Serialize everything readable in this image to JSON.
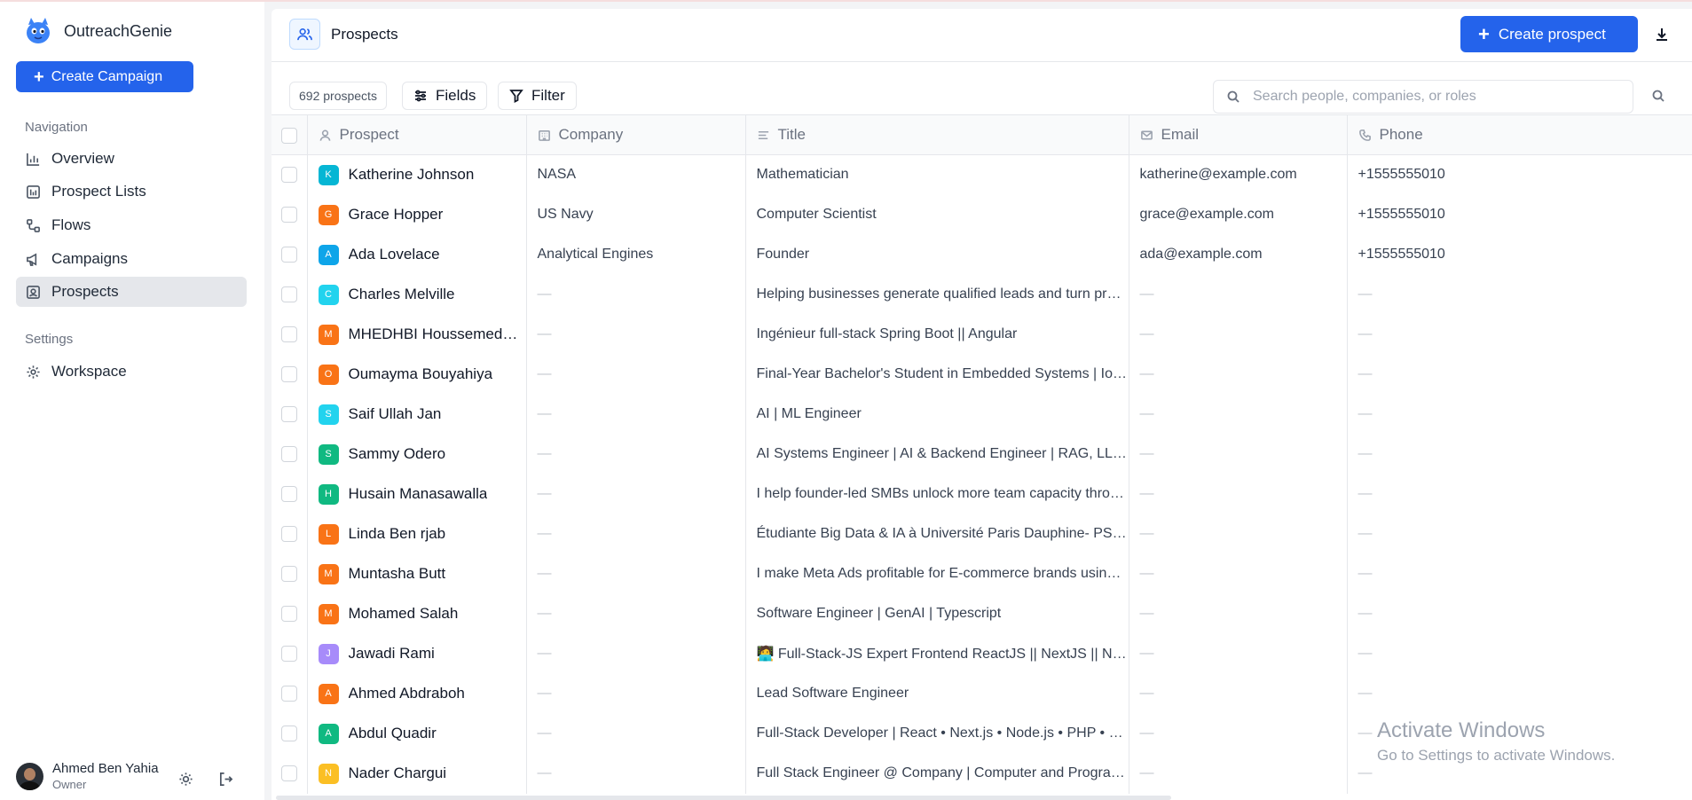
{
  "brand": {
    "name": "OutreachGenie"
  },
  "sidebar": {
    "create_label": "Create Campaign",
    "nav_heading": "Navigation",
    "nav_items": [
      {
        "label": "Overview",
        "icon": "bar-chart-icon"
      },
      {
        "label": "Prospect Lists",
        "icon": "list-icon"
      },
      {
        "label": "Flows",
        "icon": "flow-icon"
      },
      {
        "label": "Campaigns",
        "icon": "megaphone-icon"
      },
      {
        "label": "Prospects",
        "icon": "contact-icon",
        "active": true
      }
    ],
    "settings_heading": "Settings",
    "settings_items": [
      {
        "label": "Workspace",
        "icon": "gear-icon"
      }
    ],
    "user": {
      "name": "Ahmed Ben Yahia",
      "role": "Owner"
    }
  },
  "header": {
    "title": "Prospects",
    "create_label": "Create prospect"
  },
  "toolbar": {
    "count": "692 prospects",
    "fields_label": "Fields",
    "filter_label": "Filter",
    "search_placeholder": "Search people, companies, or roles"
  },
  "table": {
    "columns": [
      "Prospect",
      "Company",
      "Title",
      "Email",
      "Phone"
    ],
    "rows": [
      {
        "initial": "K",
        "color": "#06b6d4",
        "name": "Katherine Johnson",
        "company": "NASA",
        "title": "Mathematician",
        "email": "katherine@example.com",
        "phone": "+1555555010"
      },
      {
        "initial": "G",
        "color": "#f97316",
        "name": "Grace Hopper",
        "company": "US Navy",
        "title": "Computer Scientist",
        "email": "grace@example.com",
        "phone": "+1555555010"
      },
      {
        "initial": "A",
        "color": "#0ea5e9",
        "name": "Ada Lovelace",
        "company": "Analytical Engines",
        "title": "Founder",
        "email": "ada@example.com",
        "phone": "+1555555010"
      },
      {
        "initial": "C",
        "color": "#22d3ee",
        "name": "Charles Melville",
        "company": "—",
        "title": "Helping businesses generate qualified leads and turn prospects into clients",
        "email": "—",
        "phone": "—"
      },
      {
        "initial": "M",
        "color": "#f97316",
        "name": "MHEDHBI Houssemeddine",
        "company": "—",
        "title": "Ingénieur full-stack Spring Boot || Angular",
        "email": "—",
        "phone": "—"
      },
      {
        "initial": "O",
        "color": "#f97316",
        "name": "Oumayma Bouyahiya",
        "company": "—",
        "title": "Final-Year Bachelor's Student in Embedded Systems | IoT & AI Developer",
        "email": "—",
        "phone": "—"
      },
      {
        "initial": "S",
        "color": "#22d3ee",
        "name": "Saif Ullah Jan",
        "company": "—",
        "title": "AI | ML Engineer",
        "email": "—",
        "phone": "—"
      },
      {
        "initial": "S",
        "color": "#10b981",
        "name": "Sammy Odero",
        "company": "—",
        "title": "AI Systems Engineer | AI & Backend Engineer | RAG, LLM Applications",
        "email": "—",
        "phone": "—"
      },
      {
        "initial": "H",
        "color": "#10b981",
        "name": "Husain Manasawalla",
        "company": "—",
        "title": "I help founder-led SMBs unlock more team capacity through AI automation",
        "email": "—",
        "phone": "—"
      },
      {
        "initial": "L",
        "color": "#f97316",
        "name": "Linda Ben rjab",
        "company": "—",
        "title": "Étudiante Big Data & IA à Université Paris Dauphine- PSL (Nouvelle promo)",
        "email": "—",
        "phone": "—"
      },
      {
        "initial": "M",
        "color": "#f97316",
        "name": "Muntasha Butt",
        "company": "—",
        "title": "I make Meta Ads profitable for E-commerce brands using AI-optimized creatives",
        "email": "—",
        "phone": "—"
      },
      {
        "initial": "M",
        "color": "#f97316",
        "name": "Mohamed Salah",
        "company": "—",
        "title": "Software Engineer | GenAI | Typescript",
        "email": "—",
        "phone": "—"
      },
      {
        "initial": "J",
        "color": "#a78bfa",
        "name": "Jawadi Rami",
        "company": "—",
        "title": "🧑‍💻 Full-Stack-JS Expert Frontend ReactJS || NextJS || NodeJS || Express",
        "email": "—",
        "phone": "—"
      },
      {
        "initial": "A",
        "color": "#f97316",
        "name": "Ahmed Abdraboh",
        "company": "—",
        "title": "Lead Software Engineer",
        "email": "—",
        "phone": "—"
      },
      {
        "initial": "A",
        "color": "#10b981",
        "name": "Abdul Quadir",
        "company": "—",
        "title": "Full-Stack Developer | React • Next.js • Node.js • PHP • Python • AWS",
        "email": "—",
        "phone": "—"
      },
      {
        "initial": "N",
        "color": "#fbbf24",
        "name": "Nader Chargui",
        "company": "—",
        "title": "Full Stack Engineer @ Company | Computer and Programming Student",
        "email": "—",
        "phone": "—"
      }
    ]
  },
  "watermark": {
    "line1": "Activate Windows",
    "line2": "Go to Settings to activate Windows."
  }
}
